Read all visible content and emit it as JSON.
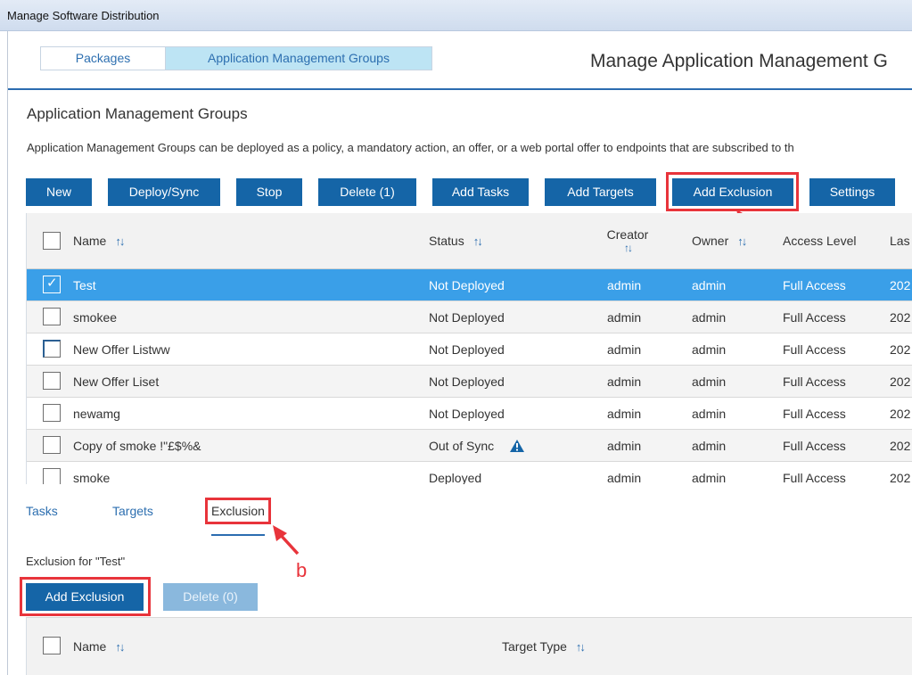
{
  "window": {
    "title": "Manage Software Distribution"
  },
  "tabs": [
    {
      "label": "Packages"
    },
    {
      "label": "Application Management Groups"
    }
  ],
  "page_title": "Manage Application Management G",
  "section": {
    "title": "Application Management Groups",
    "description": "Application Management Groups can be deployed as a policy, a mandatory action, an offer, or a web portal offer to endpoints that are subscribed to th"
  },
  "toolbar": {
    "new": "New",
    "deploy_sync": "Deploy/Sync",
    "stop": "Stop",
    "delete": "Delete (1)",
    "add_tasks": "Add Tasks",
    "add_targets": "Add Targets",
    "add_exclusion": "Add Exclusion",
    "settings": "Settings"
  },
  "grid": {
    "columns": {
      "name": "Name",
      "status": "Status",
      "creator": "Creator",
      "owner": "Owner",
      "access_level": "Access Level",
      "last": "Las"
    },
    "rows": [
      {
        "name": "Test",
        "status": "Not Deployed",
        "creator": "admin",
        "owner": "admin",
        "access": "Full Access",
        "last": "202",
        "checked": true
      },
      {
        "name": "smokee",
        "status": "Not Deployed",
        "creator": "admin",
        "owner": "admin",
        "access": "Full Access",
        "last": "202",
        "checked": false
      },
      {
        "name": "New Offer Listww",
        "status": "Not Deployed",
        "creator": "admin",
        "owner": "admin",
        "access": "Full Access",
        "last": "202",
        "checked": false
      },
      {
        "name": "New Offer Liset",
        "status": "Not Deployed",
        "creator": "admin",
        "owner": "admin",
        "access": "Full Access",
        "last": "202",
        "checked": false
      },
      {
        "name": "newamg",
        "status": "Not Deployed",
        "creator": "admin",
        "owner": "admin",
        "access": "Full Access",
        "last": "202",
        "checked": false
      },
      {
        "name": "Copy of smoke !\"£$%&",
        "status": "Out of Sync",
        "creator": "admin",
        "owner": "admin",
        "access": "Full Access",
        "last": "202",
        "checked": false
      },
      {
        "name": "smoke",
        "status": "Deployed",
        "creator": "admin",
        "owner": "admin",
        "access": "Full Access",
        "last": "202",
        "checked": false
      }
    ]
  },
  "subtabs": {
    "tasks": "Tasks",
    "targets": "Targets",
    "exclusion": "Exclusion"
  },
  "exclusion": {
    "heading": "Exclusion for \"Test\"",
    "add_button": "Add Exclusion",
    "delete_button": "Delete (0)",
    "columns": {
      "name": "Name",
      "target_type": "Target Type"
    }
  },
  "annotations": {
    "a": "a",
    "b": "b"
  },
  "colors": {
    "accent": "#1565a7",
    "selected_row": "#3a9fe8",
    "annotation": "#e8343b",
    "tab_active": "#bde4f4"
  },
  "icons": {
    "sort": "sort-updown-icon",
    "warning": "warning-triangle-icon",
    "check": "checkmark-icon"
  }
}
